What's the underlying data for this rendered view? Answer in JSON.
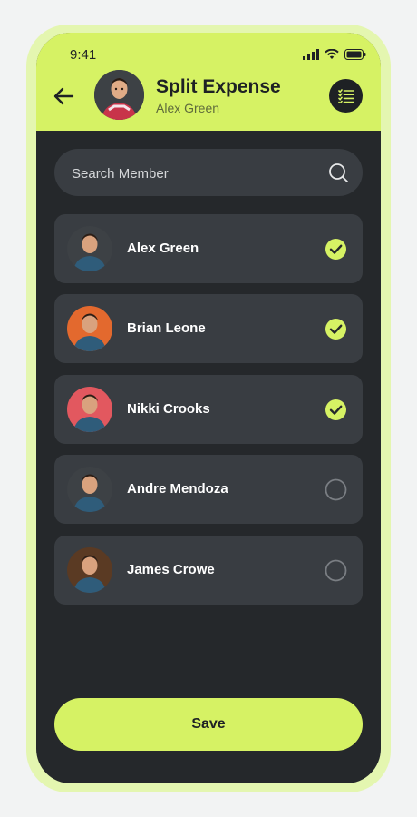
{
  "status_bar": {
    "time": "9:41"
  },
  "header": {
    "title": "Split Expense",
    "subtitle": "Alex Green",
    "back_icon": "arrow-left-icon",
    "menu_icon": "checklist-icon"
  },
  "search": {
    "placeholder": "Search Member",
    "value": "",
    "icon": "search-icon"
  },
  "members": [
    {
      "name": "Alex Green",
      "selected": true,
      "avatar_bg": "#3d4145"
    },
    {
      "name": "Brian Leone",
      "selected": true,
      "avatar_bg": "#e3692e"
    },
    {
      "name": "Nikki Crooks",
      "selected": true,
      "avatar_bg": "#e2585f"
    },
    {
      "name": "Andre Mendoza",
      "selected": false,
      "avatar_bg": "#3d4145"
    },
    {
      "name": "James Crowe",
      "selected": false,
      "avatar_bg": "#5a3a23"
    }
  ],
  "save_label": "Save",
  "colors": {
    "accent": "#d6f264",
    "background": "#25282b",
    "card": "#393d42"
  }
}
